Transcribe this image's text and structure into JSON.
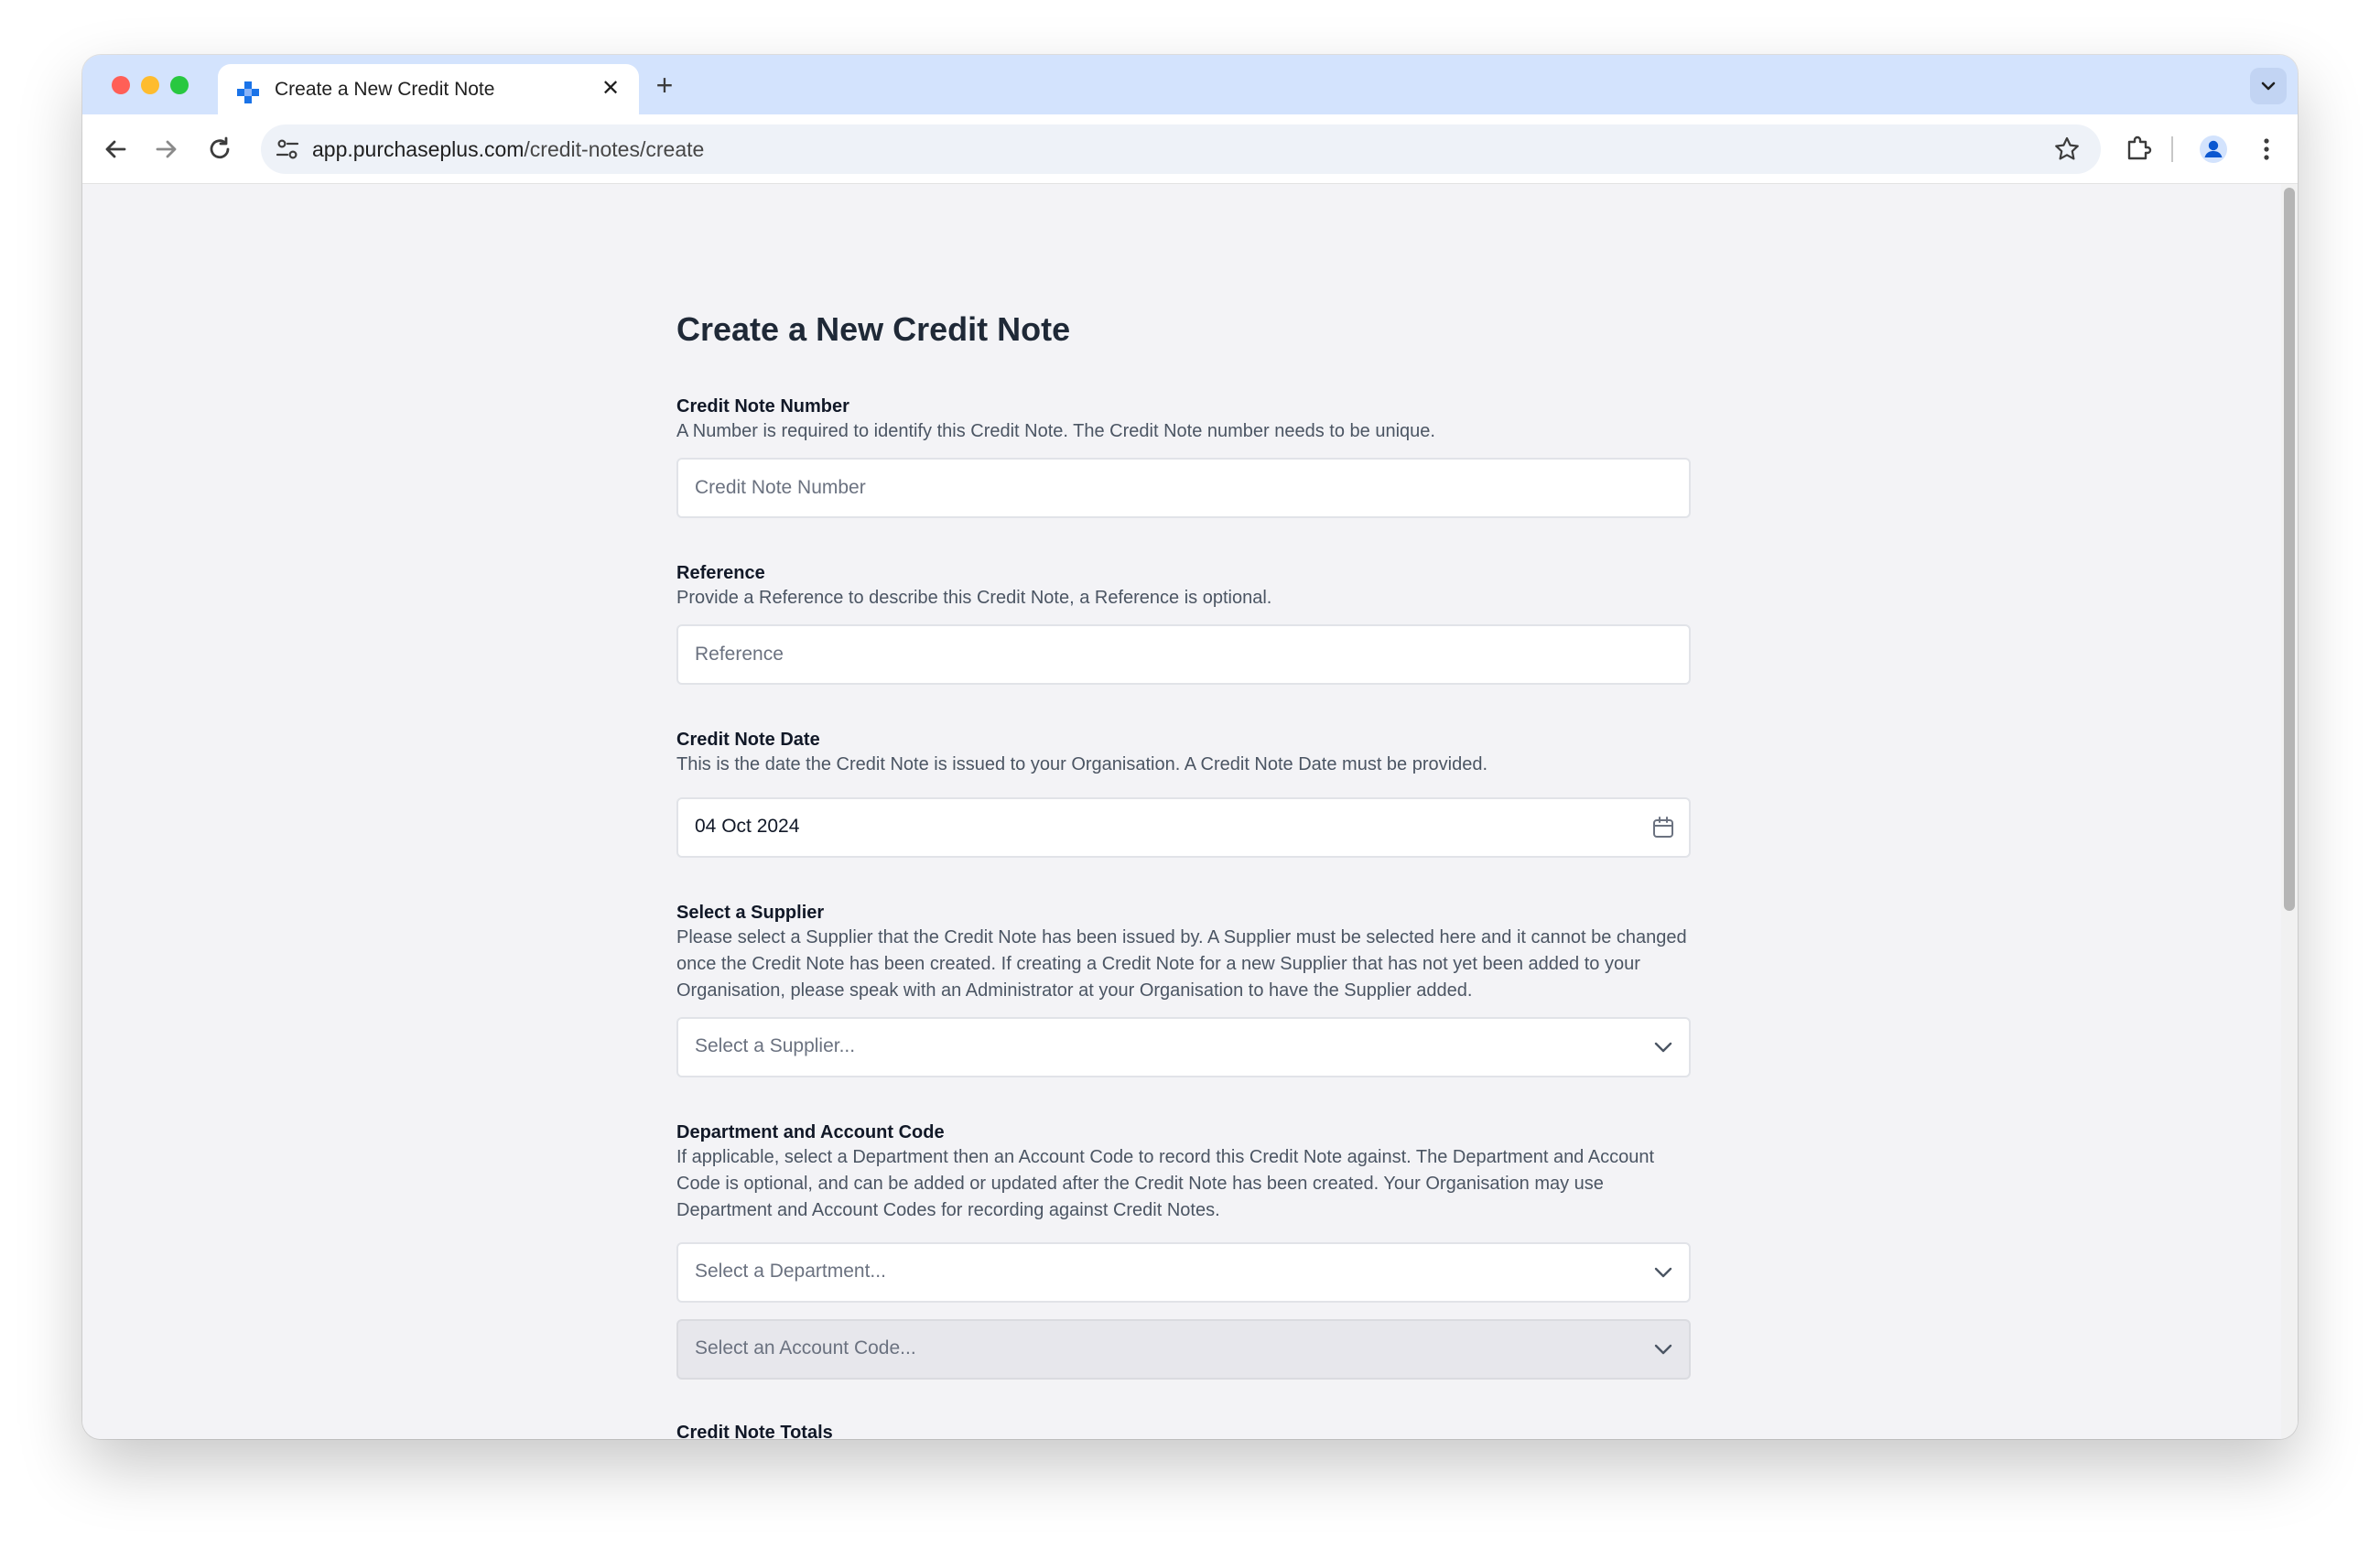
{
  "browser": {
    "tab_title": "Create a New Credit Note",
    "url_domain": "app.purchaseplus.com",
    "url_path": "/credit-notes/create"
  },
  "page": {
    "title": "Create a New Credit Note"
  },
  "form": {
    "credit_note_number": {
      "label": "Credit Note Number",
      "description": "A Number is required to identify this Credit Note. The Credit Note number needs to be unique.",
      "placeholder": "Credit Note Number",
      "value": ""
    },
    "reference": {
      "label": "Reference",
      "description": "Provide a Reference to describe this Credit Note, a Reference is optional.",
      "placeholder": "Reference",
      "value": ""
    },
    "credit_note_date": {
      "label": "Credit Note Date",
      "description": "This is the date the Credit Note is issued to your Organisation. A Credit Note Date must be provided.",
      "value": "04 Oct 2024"
    },
    "supplier": {
      "label": "Select a Supplier",
      "description": "Please select a Supplier that the Credit Note has been issued by. A Supplier must be selected here and it cannot be changed once the Credit Note has been created. If creating a Credit Note for a new Supplier that has not yet been added to your Organisation, please speak with an Administrator at your Organisation to have the Supplier added.",
      "placeholder": "Select a Supplier..."
    },
    "department_account": {
      "label": "Department and Account Code",
      "description": "If applicable, select a Department then an Account Code to record this Credit Note against. The Department and Account Code is optional, and can be added or updated after the Credit Note has been created. Your Organisation may use Department and Account Codes for recording against Credit Notes.",
      "department_placeholder": "Select a Department...",
      "account_placeholder": "Select an Account Code..."
    },
    "totals": {
      "label": "Credit Note Totals"
    }
  },
  "colors": {
    "tabstrip": "#d3e3fd",
    "page_bg": "#f3f3f6",
    "title": "#1f2937",
    "favicon": "#1a73e8"
  },
  "icons": {
    "back": "arrow-left-icon",
    "forward": "arrow-right-icon",
    "reload": "reload-icon",
    "site_settings": "tune-icon",
    "bookmark": "star-icon",
    "extensions": "puzzle-icon",
    "profile": "avatar-icon",
    "menu": "kebab-menu-icon",
    "calendar": "calendar-icon",
    "dropdown": "chevron-down-icon"
  }
}
